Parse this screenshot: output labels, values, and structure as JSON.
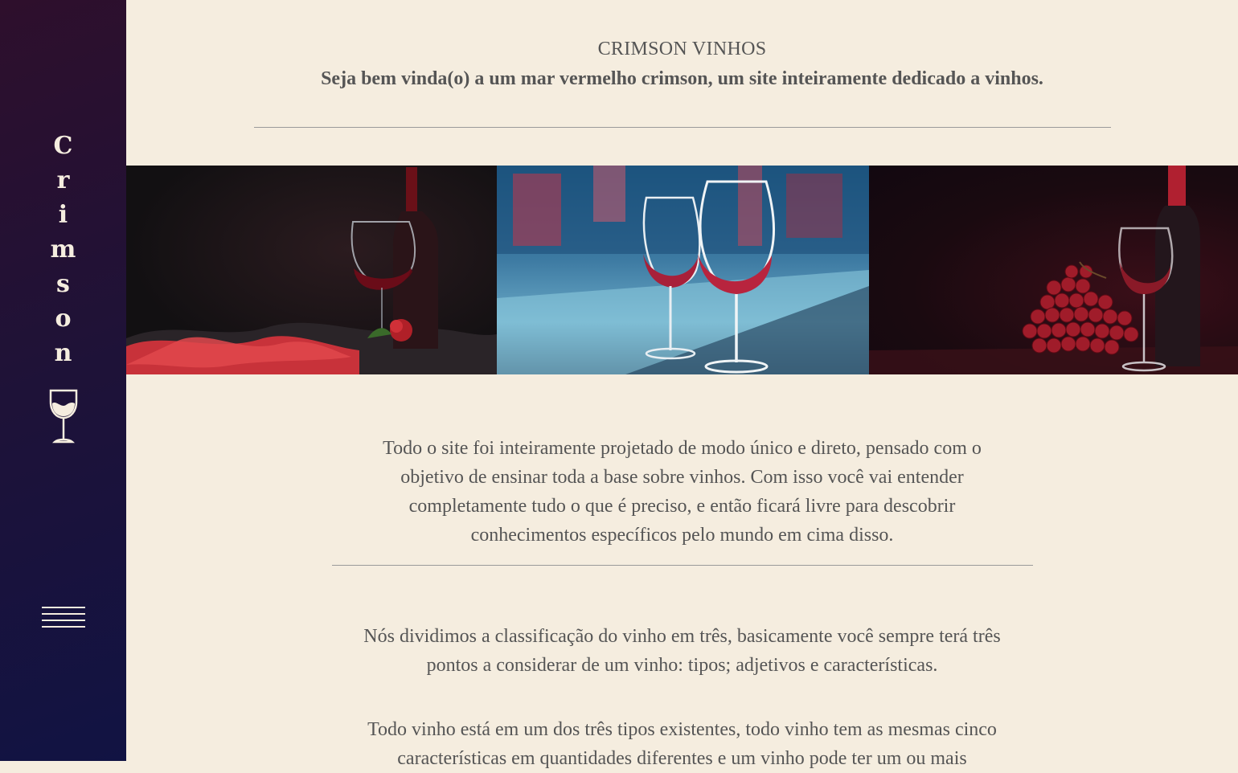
{
  "sidebar": {
    "brand_letters": [
      "C",
      "r",
      "i",
      "m",
      "s",
      "o",
      "n"
    ],
    "logo_icon": "wine-glass-icon",
    "menu_icon": "hamburger-menu-icon"
  },
  "header": {
    "title": "CRIMSON VINHOS",
    "subtitle": "Seja bem vinda(o) a um mar vermelho crimson, um site inteiramente dedicado a vinhos."
  },
  "gallery": {
    "images": [
      {
        "name": "wine-bottle-glass-rose-photo"
      },
      {
        "name": "two-wine-glasses-bar-photo"
      },
      {
        "name": "wine-bottle-glass-grapes-photo"
      }
    ]
  },
  "content": {
    "intro": "Todo o site foi inteiramente projetado de modo único e direto, pensado com o objetivo de ensinar toda a base sobre vinhos. Com isso você vai entender completamente tudo o que é preciso, e então ficará livre para descobrir conhecimentos específicos pelo mundo em cima disso.",
    "classification": "Nós dividimos a classificação do vinho em três, basicamente você sempre terá três pontos a considerar de um vinho: tipos; adjetivos e características.",
    "types": "Todo vinho está em um dos três tipos existentes, todo vinho tem as mesmas cinco características em quantidades diferentes e um vinho pode ter um ou mais"
  },
  "colors": {
    "background": "#f5eddf",
    "sidebar_top": "#2e0f2c",
    "sidebar_bottom": "#111343",
    "text": "#555555",
    "accent_wine": "#8a1a24"
  }
}
